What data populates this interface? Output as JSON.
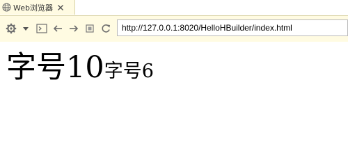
{
  "tab": {
    "label": "Web浏览器",
    "icon": "globe-icon",
    "close_icon": "close-icon"
  },
  "toolbar": {
    "icons": [
      "gear-icon",
      "dropdown-arrow-icon",
      "console-icon",
      "back-icon",
      "forward-icon",
      "stop-icon",
      "refresh-icon"
    ],
    "url": "http://127.0.0.1:8020/HelloHBuilder/index.html"
  },
  "page": {
    "text_large": "字号10",
    "text_small": "字号6"
  },
  "colors": {
    "toolbar_bg": "#fffbe2",
    "border": "#d9d3a6",
    "icon": "#6d6d6d"
  }
}
